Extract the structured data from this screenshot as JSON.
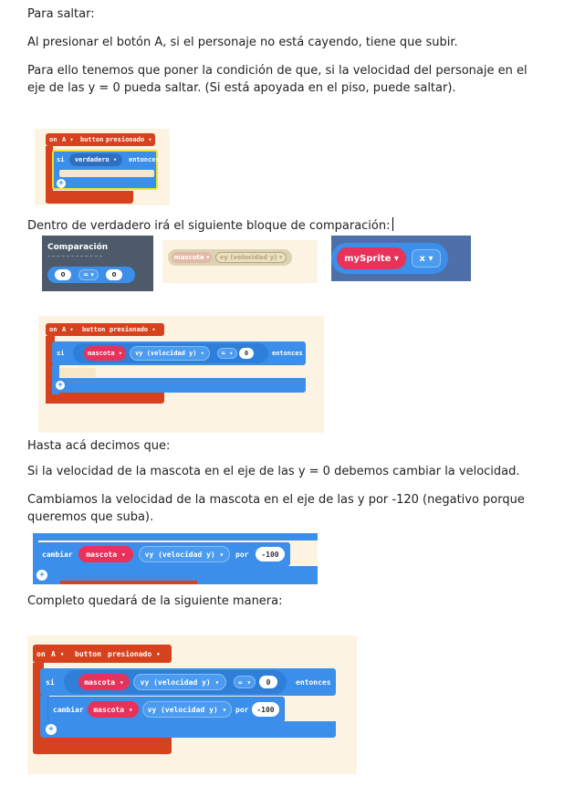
{
  "paragraphs": {
    "p1": "Para saltar:",
    "p2": "Al presionar el botón A, si el personaje no está cayendo, tiene que subir.",
    "p3": "Para ello tenemos que poner la condición de que, si la velocidad del personaje en el eje de las y = 0 pueda saltar. (Si está apoyada en el piso, puede saltar).",
    "p4": "Dentro de verdadero irá el siguiente bloque de comparación:",
    "p5": "Hasta acá decimos que:",
    "p6": "Si la velocidad de la mascota en el eje de las y = 0 debemos cambiar la velocidad.",
    "p7": "Cambiamos la velocidad de la mascota en el eje de las y por -120 (negativo porque queremos que suba).",
    "p8": "Completo quedará de la siguiente manera:"
  },
  "blocks": {
    "on": "on",
    "button_a": "A ▾",
    "button": "button",
    "presionado": "presionado ▾",
    "si": "si",
    "verdadero": "verdadero ▾",
    "entonces": "entonces",
    "comparacion": "Comparación",
    "zero": "0",
    "eq": "= ▾",
    "mascota": "mascota ▾",
    "vy": "vy (velocidad y) ▾",
    "mysprite": "mySprite ▾",
    "x": "x ▾",
    "cambiar": "cambiar",
    "por": "por",
    "minus100": "-100",
    "plus": "+"
  }
}
